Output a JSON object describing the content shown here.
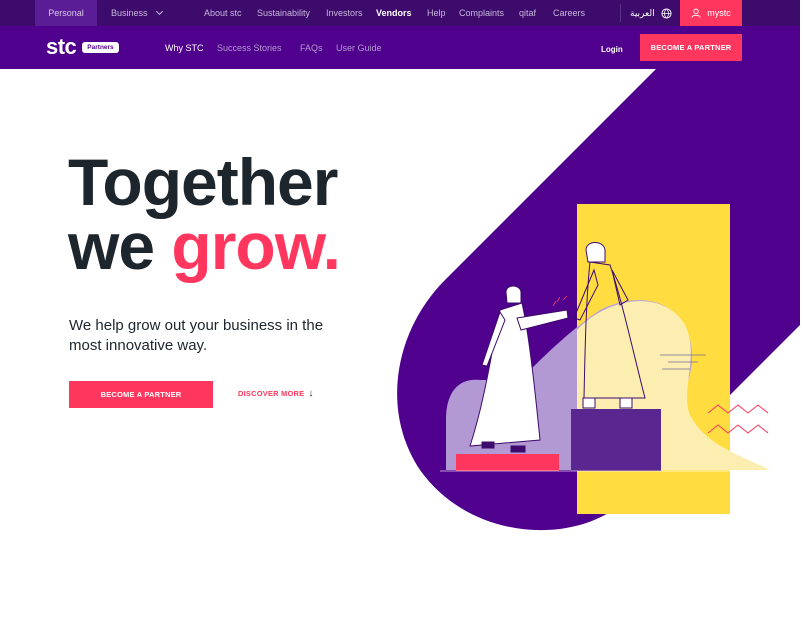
{
  "topbar": {
    "personal": "Personal",
    "business": "Business",
    "links": [
      "About stc",
      "Sustainability",
      "Investors",
      "Vendors",
      "Help",
      "Complaints",
      "qitaf",
      "Careers"
    ],
    "language": "العربية",
    "mystc": "mystc"
  },
  "nav": {
    "logo": "stc",
    "logo_badge": "Partners",
    "items": [
      "Why STC",
      "Success Stories",
      "FAQs",
      "User Guide"
    ],
    "login": "Login",
    "cta": "BECOME A PARTNER"
  },
  "hero": {
    "title_line1": "Together",
    "title_line2_a": "we ",
    "title_line2_b": "grow.",
    "subtitle": "We help grow out your business in the most innovative way.",
    "cta": "BECOME A PARTNER",
    "discover": "DISCOVER MORE"
  },
  "colors": {
    "brand_purple": "#4f008c",
    "topbar": "#3d0b6b",
    "accent_pink": "#ff375e",
    "yellow": "#ffdd40"
  }
}
